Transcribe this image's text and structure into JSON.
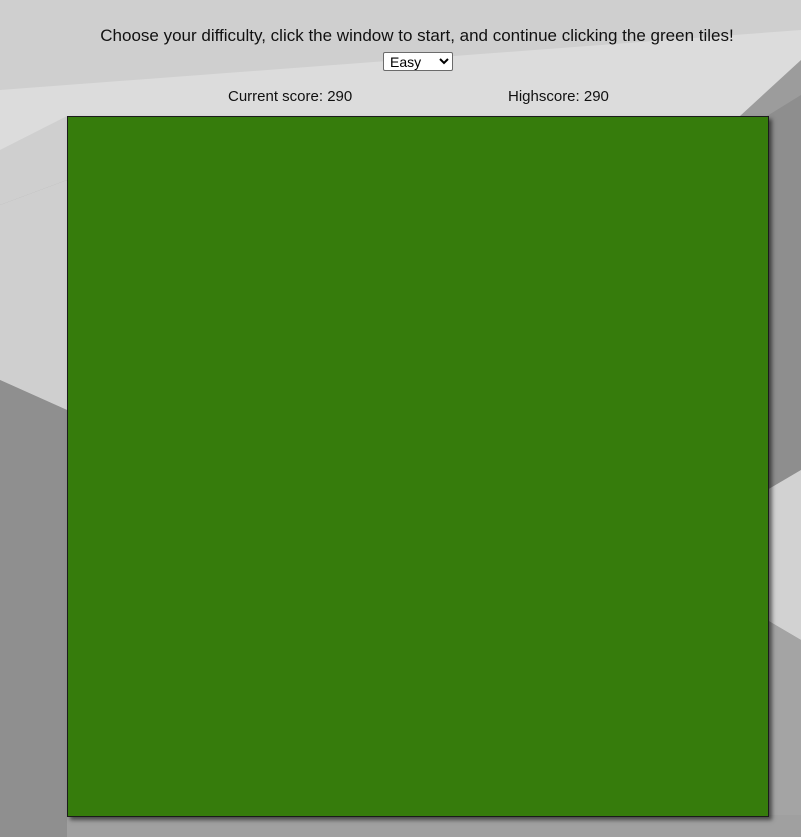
{
  "header": {
    "instructions": "Choose your difficulty, click the window to start, and continue clicking the green tiles!"
  },
  "difficulty": {
    "selected": "Easy",
    "options": [
      "Easy"
    ]
  },
  "scores": {
    "current_label": "Current score: 290",
    "high_label": "Highscore: 290"
  },
  "game": {
    "tile_color": "#367c0c"
  }
}
